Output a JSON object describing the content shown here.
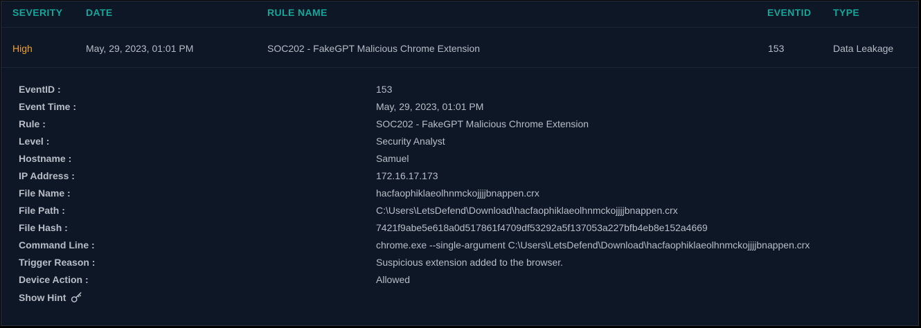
{
  "table": {
    "headers": {
      "severity": "SEVERITY",
      "date": "DATE",
      "rule_name": "RULE NAME",
      "eventid": "EVENTID",
      "type": "TYPE"
    },
    "row": {
      "severity": "High",
      "date": "May, 29, 2023, 01:01 PM",
      "rule_name": "SOC202 - FakeGPT Malicious Chrome Extension",
      "eventid": "153",
      "type": "Data Leakage"
    }
  },
  "details": [
    {
      "label": "EventID :",
      "value": "153"
    },
    {
      "label": "Event Time :",
      "value": "May, 29, 2023, 01:01 PM"
    },
    {
      "label": "Rule :",
      "value": "SOC202 - FakeGPT Malicious Chrome Extension"
    },
    {
      "label": "Level :",
      "value": "Security Analyst"
    },
    {
      "label": "Hostname :",
      "value": "Samuel"
    },
    {
      "label": "IP Address :",
      "value": "172.16.17.173"
    },
    {
      "label": "File Name :",
      "value": "hacfaophiklaeolhnmckojjjjbnappen.crx"
    },
    {
      "label": "File Path :",
      "value": "C:\\Users\\LetsDefend\\Download\\hacfaophiklaeolhnmckojjjjbnappen.crx"
    },
    {
      "label": "File Hash :",
      "value": "7421f9abe5e618a0d517861f4709df53292a5f137053a227bfb4eb8e152a4669"
    },
    {
      "label": "Command Line :",
      "value": "chrome.exe --single-argument C:\\Users\\LetsDefend\\Download\\hacfaophiklaeolhnmckojjjjbnappen.crx"
    },
    {
      "label": "Trigger Reason :",
      "value": "Suspicious extension added to the browser."
    },
    {
      "label": "Device Action :",
      "value": "Allowed"
    }
  ],
  "hint": {
    "label": "Show Hint",
    "icon": "key-icon"
  },
  "colors": {
    "background": "#0e1726",
    "header_accent": "#17a59a",
    "severity_high": "#f0a030",
    "text": "#b8bec8"
  }
}
